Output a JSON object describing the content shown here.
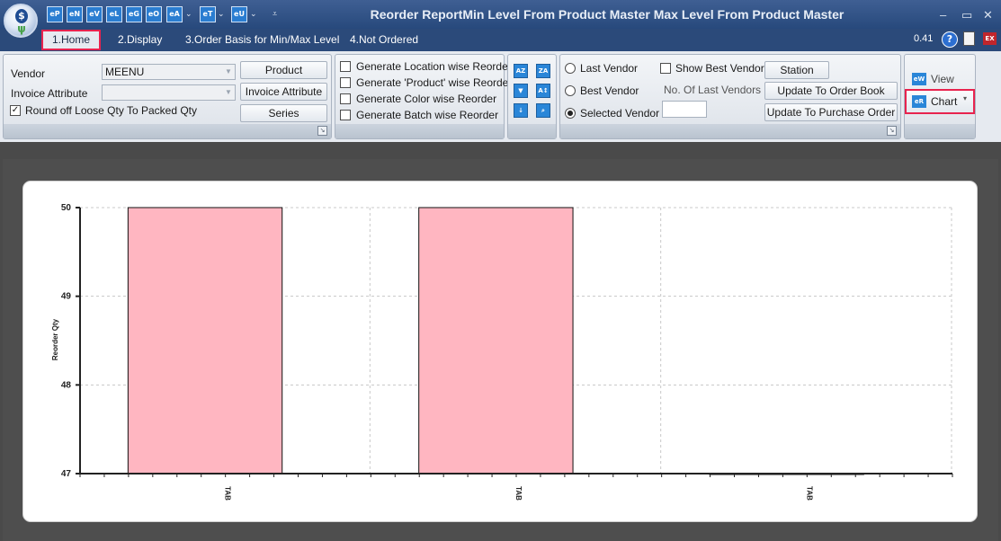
{
  "window": {
    "title": "Reorder ReportMin Level From Product Master Max Level From Product Master",
    "version": "0.41",
    "controls": {
      "minimize": "–",
      "maximize": "▭",
      "close": "✕"
    }
  },
  "quick_access": [
    {
      "label": "eP"
    },
    {
      "label": "eN"
    },
    {
      "label": "eV"
    },
    {
      "label": "eL"
    },
    {
      "label": "eG"
    },
    {
      "label": "eO"
    },
    {
      "label": "eA"
    },
    {
      "label": "eT"
    },
    {
      "label": "eU"
    }
  ],
  "tabs": [
    {
      "label": "1.Home",
      "active": true
    },
    {
      "label": "2.Display"
    },
    {
      "label": "3.Order Basis for Min/Max Level"
    },
    {
      "label": "4.Not Ordered"
    }
  ],
  "ribbon": {
    "vendor_label": "Vendor",
    "vendor_value": "MEENU",
    "invoice_attribute_label": "Invoice Attribute",
    "invoice_attribute_value": "",
    "round_off_label": "Round off Loose Qty To Packed Qty",
    "round_off_checked": true,
    "buttons": {
      "product": "Product",
      "invoice_attribute": "Invoice Attribute",
      "series": "Series"
    },
    "generate": [
      {
        "label": "Generate Location wise Reorder",
        "checked": false
      },
      {
        "label": "Generate 'Product' wise Reorder",
        "checked": false
      },
      {
        "label": "Generate Color wise Reorder",
        "checked": false
      },
      {
        "label": "Generate Batch wise Reorder",
        "checked": false
      }
    ],
    "icon_grid": [
      "sort-ascending-icon",
      "sort-descending-icon",
      "filter-icon",
      "sort-alpha-icon",
      "sort-by-icon",
      "find-icon"
    ],
    "vendor_mode": {
      "last_vendor": "Last Vendor",
      "best_vendor": "Best Vendor",
      "selected_vendor": "Selected Vendor",
      "selected": "selected_vendor"
    },
    "show_best_vendor": "Show Best Vendor",
    "no_of_last_vendors": "No. Of Last Vendors",
    "no_of_last_vendors_value": "",
    "station": "Station",
    "update_order_book": "Update To Order Book",
    "update_purchase_order": "Update To Purchase Order",
    "view": "View",
    "chart": "Chart"
  },
  "chart_data": {
    "type": "bar",
    "ylabel": "Reorder Qty",
    "ylim": [
      47,
      50
    ],
    "yticks": [
      47,
      48,
      49,
      50
    ],
    "categories": [
      "TAB",
      "TAB",
      "TAB"
    ],
    "values": [
      50,
      50,
      47
    ],
    "bar_color": "#ffb6c1",
    "grid": true
  },
  "colors": {
    "highlight": "#e8234e",
    "bar": "#ffb6c1"
  }
}
